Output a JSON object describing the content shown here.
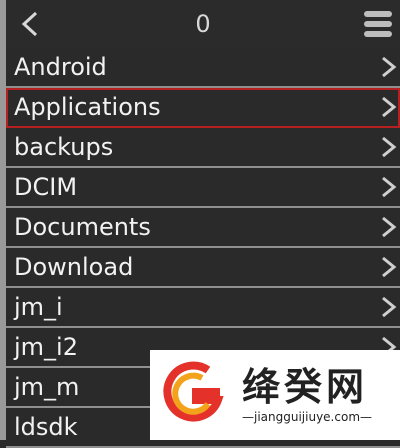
{
  "header": {
    "title": "0",
    "back_icon": "chevron-left-icon",
    "menu_icon": "stack-menu-icon"
  },
  "folders": [
    {
      "name": "Android"
    },
    {
      "name": "Applications",
      "selected": true
    },
    {
      "name": "backups"
    },
    {
      "name": "DCIM"
    },
    {
      "name": "Documents"
    },
    {
      "name": "Download"
    },
    {
      "name": "jm_i"
    },
    {
      "name": "jm_i2"
    },
    {
      "name": "jm_m"
    },
    {
      "name": "ldsdk"
    }
  ],
  "watermark": {
    "title": "绛癸网",
    "url": "—jiangguijiuye.com—"
  },
  "colors": {
    "background": "#2a2a2a",
    "text": "#f2f2f2",
    "divider": "#8f8f8f",
    "selection": "#b52121"
  }
}
